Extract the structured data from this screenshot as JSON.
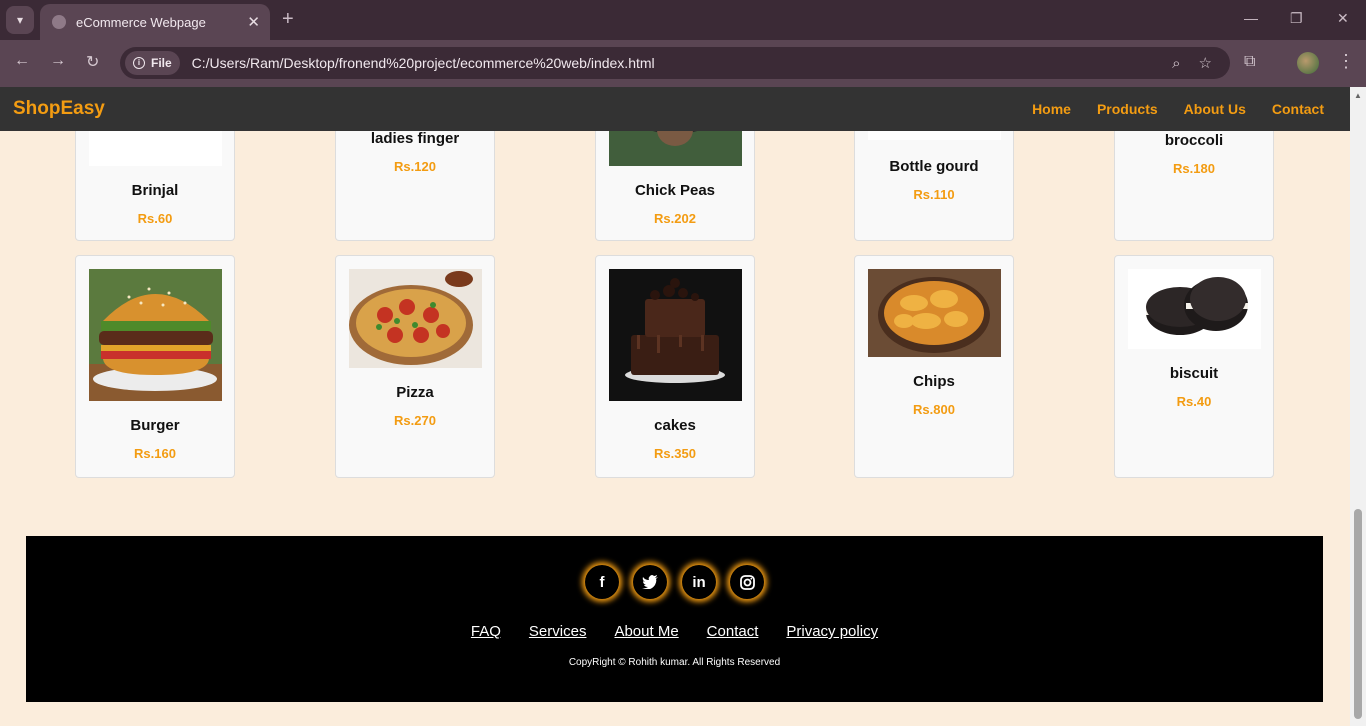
{
  "browser": {
    "tab_title": "eCommerce Webpage",
    "address_chip": "File",
    "url": "C:/Users/Ram/Desktop/fronend%20project/ecommerce%20web/index.html"
  },
  "navbar": {
    "brand": "ShopEasy",
    "links": [
      "Home",
      "Products",
      "About Us",
      "Contact"
    ]
  },
  "products_row1": [
    {
      "name": "Brinjal",
      "price": "Rs.60"
    },
    {
      "name": "ladies finger",
      "price": "Rs.120"
    },
    {
      "name": "Chick Peas",
      "price": "Rs.202"
    },
    {
      "name": "Bottle gourd",
      "price": "Rs.110"
    },
    {
      "name": "broccoli",
      "price": "Rs.180"
    }
  ],
  "products_row2": [
    {
      "name": "Burger",
      "price": "Rs.160"
    },
    {
      "name": "Pizza",
      "price": "Rs.270"
    },
    {
      "name": "cakes",
      "price": "Rs.350"
    },
    {
      "name": "Chips",
      "price": "Rs.800"
    },
    {
      "name": "biscuit",
      "price": "Rs.40"
    }
  ],
  "footer": {
    "social": [
      "facebook-icon",
      "twitter-icon",
      "linkedin-icon",
      "instagram-icon"
    ],
    "links": [
      "FAQ",
      "Services",
      "About Me",
      "Contact",
      "Privacy policy"
    ],
    "copyright": "CopyRight © Rohith kumar. All Rights Reserved"
  },
  "colors": {
    "accent": "#f39c12",
    "navbar": "#333333",
    "background": "#fbeddc",
    "footer": "#000000"
  }
}
